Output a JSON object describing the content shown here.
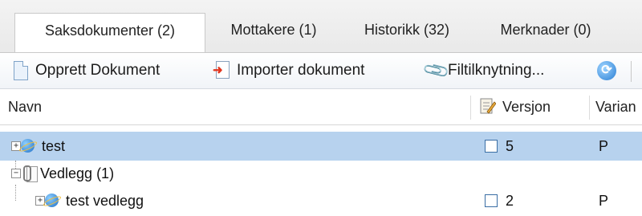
{
  "tabs": [
    {
      "label": "Saksdokumenter (2)",
      "active": true
    },
    {
      "label": "Mottakere (1)",
      "active": false
    },
    {
      "label": "Historikk (32)",
      "active": false
    },
    {
      "label": "Merknader (0)",
      "active": false
    }
  ],
  "toolbar": {
    "create_label": "Opprett Dokument",
    "import_label": "Importer dokument",
    "attach_label": "Filtilknytning...",
    "refresh_icon": "refresh-icon"
  },
  "grid": {
    "columns": {
      "name": "Navn",
      "version": "Versjon",
      "variant": "Varian"
    },
    "rows": [
      {
        "name": "test",
        "version": "5",
        "variant": "P",
        "selected": true
      },
      {
        "name": "Vedlegg (1)",
        "version": "",
        "variant": "",
        "selected": false
      },
      {
        "name": "test vedlegg",
        "version": "2",
        "variant": "P",
        "selected": false
      }
    ]
  },
  "colors": {
    "selected_row": "#b7d2ee",
    "checkbox_border": "#3a6ea5"
  }
}
